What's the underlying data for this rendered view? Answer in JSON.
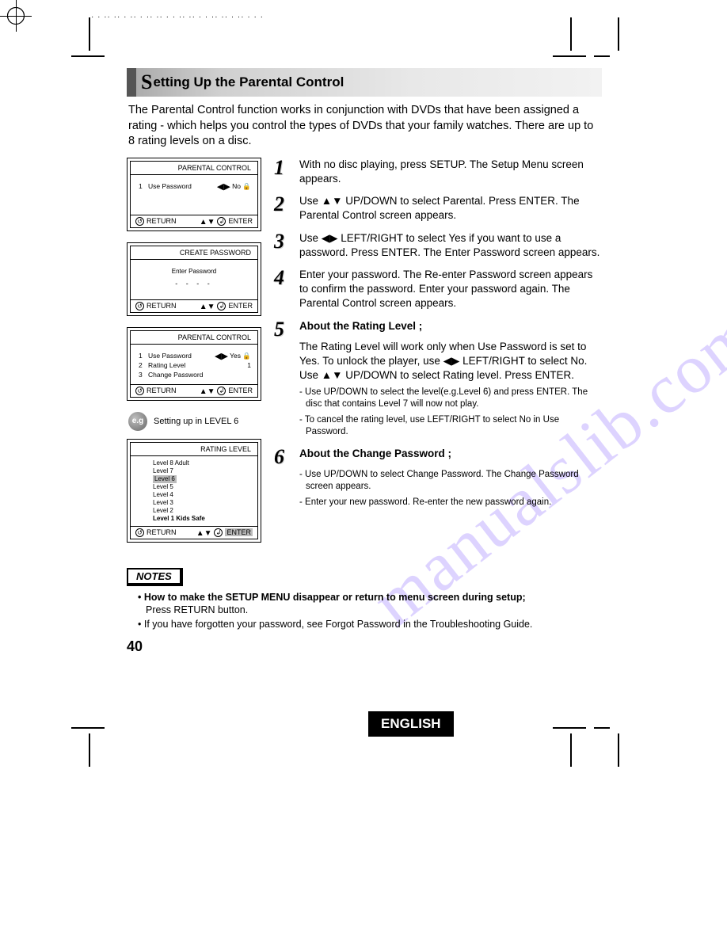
{
  "watermark": "manualslib.com",
  "heading": {
    "first_letter": "S",
    "rest": "etting Up the Parental Control"
  },
  "intro": "The Parental Control function works in conjunction with DVDs that have been assigned a rating - which helps you control the types of DVDs that your family watches. There are up to 8 rating levels on a disc.",
  "osd": {
    "screen1": {
      "title": "PARENTAL CONTROL",
      "row1_num": "1",
      "row1_label": "Use Password",
      "row1_value": "No",
      "foot_left": "RETURN",
      "foot_right": "ENTER"
    },
    "screen2": {
      "title": "CREATE PASSWORD",
      "center_label": "Enter Password",
      "dashes": "- - - -",
      "foot_left": "RETURN",
      "foot_right": "ENTER"
    },
    "screen3": {
      "title": "PARENTAL CONTROL",
      "r1n": "1",
      "r1l": "Use Password",
      "r1v": "Yes",
      "r2n": "2",
      "r2l": "Rating Level",
      "r2v": "1",
      "r3n": "3",
      "r3l": "Change Password",
      "r3v": "",
      "foot_left": "RETURN",
      "foot_right": "ENTER"
    },
    "eg_badge": "e.g",
    "eg_text": "Setting up in LEVEL 6",
    "screen4": {
      "title": "RATING LEVEL",
      "levels": [
        "Level 8 Adult",
        "Level 7",
        "Level 6",
        "Level 5",
        "Level 4",
        "Level 3",
        "Level 2",
        "Level 1 Kids Safe"
      ],
      "selected": "Level 6",
      "foot_left": "RETURN",
      "foot_right": "ENTER"
    }
  },
  "steps": {
    "s1": "With no disc playing, press SETUP. The Setup Menu screen appears.",
    "s2": "Use ▲▼ UP/DOWN to select Parental. Press ENTER. The Parental Control screen appears.",
    "s3": "Use ◀▶ LEFT/RIGHT to select Yes if you want to use a password. Press ENTER. The Enter Password screen appears.",
    "s4": "Enter your password. The Re-enter Password screen appears to confirm the password. Enter your password again. The Parental Control screen appears.",
    "s5_head": "About the Rating Level ;",
    "s5_body": "The Rating Level will work only when Use Password is set to Yes. To unlock the player, use ◀▶ LEFT/RIGHT to select No. Use ▲▼ UP/DOWN to select Rating level. Press ENTER.",
    "s5_sub1": "- Use UP/DOWN to select the level(e.g.Level 6) and press ENTER. The disc that contains Level 7 will now not play.",
    "s5_sub2": "- To cancel the rating level, use LEFT/RIGHT to select No in Use Password.",
    "s6_head": "About the Change Password ;",
    "s6_sub1": "- Use UP/DOWN to select Change Password. The Change Password screen appears.",
    "s6_sub2": "- Enter your new password. Re-enter the new password again."
  },
  "notes": {
    "label": "NOTES",
    "n1_lead": "• How to make the SETUP MENU disappear or return to menu screen during setup;",
    "n1_body": "Press RETURN button.",
    "n2": "• If you have forgotten your password, see Forgot Password in the Troubleshooting Guide."
  },
  "page_number": "40",
  "language_badge": "ENGLISH",
  "symbols": {
    "lr": "◀▶",
    "ud": "▲▼",
    "lock": "🔒",
    "return_glyph": "↺",
    "enter_glyph": "↲"
  }
}
